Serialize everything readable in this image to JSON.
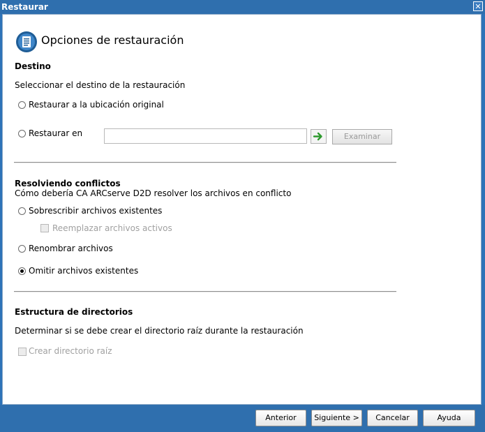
{
  "window": {
    "title": "Restaurar",
    "close_symbol": "✕"
  },
  "header": {
    "title": "Opciones de restauración"
  },
  "destination": {
    "title": "Destino",
    "description": "Seleccionar el destino de la restauración",
    "option_original": "Restaurar a la ubicación original",
    "option_restore_to": "Restaurar en",
    "path_value": "",
    "browse_label": "Examinar"
  },
  "conflicts": {
    "title": "Resolviendo conflictos",
    "description": "Cómo debería CA ARCserve D2D resolver los archivos en conflicto",
    "option_overwrite": "Sobrescribir archivos existentes",
    "option_replace_active": "Reemplazar archivos activos",
    "option_rename": "Renombrar archivos",
    "option_skip": "Omitir archivos existentes",
    "selected": "skip"
  },
  "directory": {
    "title": "Estructura de directorios",
    "description": "Determinar si se debe crear el directorio raíz durante la restauración",
    "option_create_root": "Crear directorio raíz"
  },
  "footer": {
    "previous": "Anterior",
    "next": "Siguiente >",
    "cancel": "Cancelar",
    "help": "Ayuda"
  },
  "colors": {
    "titlebar": "#2f6fae",
    "accent_green": "#2e9a2e"
  }
}
